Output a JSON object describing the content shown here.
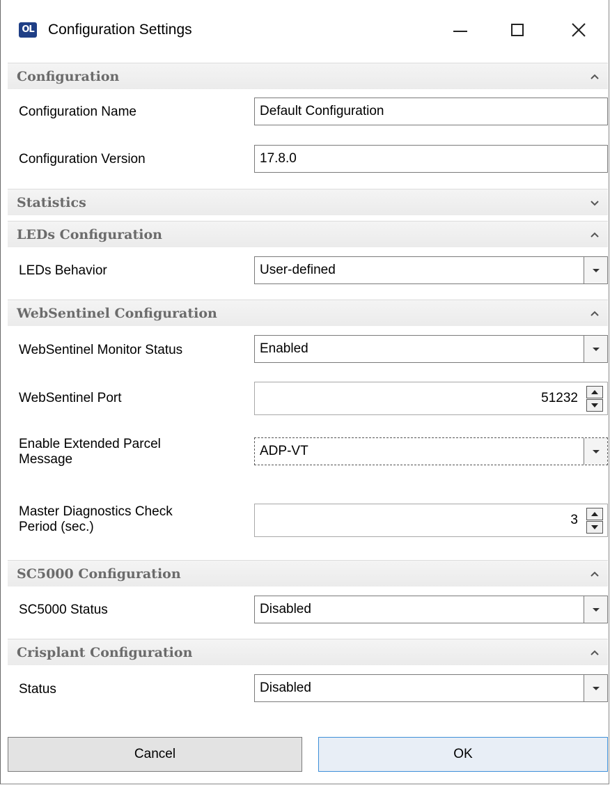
{
  "window": {
    "title": "Configuration Settings",
    "icon_label": "OL",
    "icon_color": "#1f3f86"
  },
  "sections": {
    "configuration": {
      "title": "Configuration",
      "expanded": true,
      "name_label": "Configuration Name",
      "name_value": "Default Configuration",
      "version_label": "Configuration Version",
      "version_value": "17.8.0"
    },
    "statistics": {
      "title": "Statistics",
      "expanded": false
    },
    "leds": {
      "title": "LEDs Configuration",
      "expanded": true,
      "behavior_label": "LEDs Behavior",
      "behavior_value": "User-defined"
    },
    "websentinel": {
      "title": "WebSentinel Configuration",
      "expanded": true,
      "monitor_label": "WebSentinel Monitor Status",
      "monitor_value": "Enabled",
      "port_label": "WebSentinel Port",
      "port_value": "51232",
      "extended_label_line1": "Enable Extended Parcel",
      "extended_label_line2": "Message",
      "extended_value": "ADP-VT",
      "diag_label_line1": "Master Diagnostics Check",
      "diag_label_line2": "Period (sec.)",
      "diag_value": "3"
    },
    "sc5000": {
      "title": "SC5000 Configuration",
      "expanded": true,
      "status_label": "SC5000 Status",
      "status_value": "Disabled"
    },
    "crisplant": {
      "title": "Crisplant Configuration",
      "expanded": true,
      "status_label": "Status",
      "status_value": "Disabled"
    }
  },
  "buttons": {
    "cancel": "Cancel",
    "ok": "OK"
  },
  "colors": {
    "section_header_bg": "#ebebeb",
    "section_title": "#6b6b6b",
    "ok_border": "#3d8fd8"
  }
}
